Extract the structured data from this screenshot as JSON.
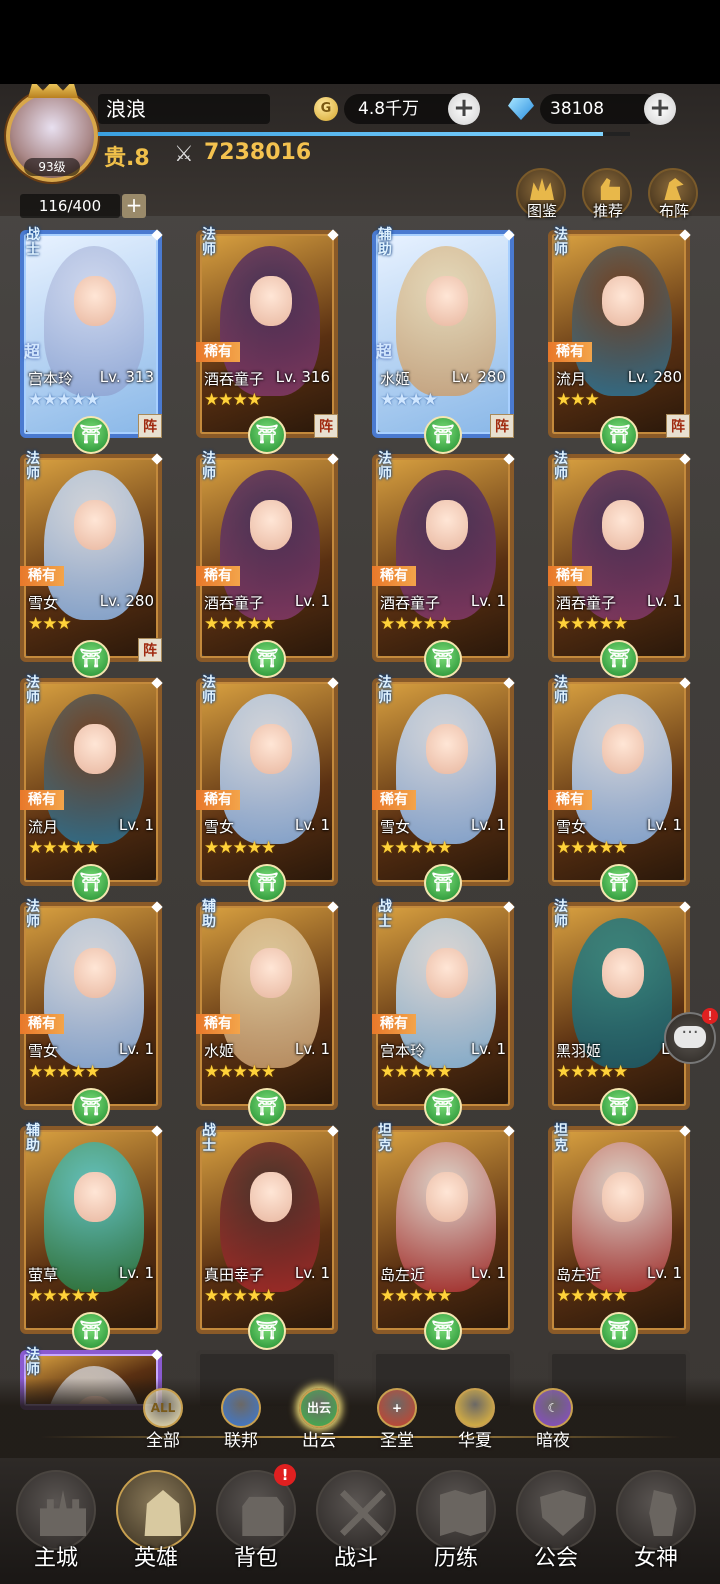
{
  "player": {
    "name": "浪浪",
    "level": "93级",
    "vip": "贵.8",
    "power": "7238016",
    "gold": "4.8千万",
    "gold_icon": "G",
    "diamonds": "38108",
    "hero_slots": "116/400",
    "exp_fraction": 0.95
  },
  "top_buttons": [
    {
      "icon": "crown-icon",
      "label": "图鉴"
    },
    {
      "icon": "thumbs-up-icon",
      "label": "推荐"
    },
    {
      "icon": "formation-icon",
      "label": "布阵"
    }
  ],
  "heroes": [
    {
      "name": "宫本玲",
      "level": "Lv. 313",
      "role": "战士",
      "rarity": "超",
      "stars": 5,
      "star_style": "blue",
      "frame": "blue",
      "faction": "出云",
      "in_formation": "阵"
    },
    {
      "name": "酒吞童子",
      "level": "Lv. 316",
      "role": "法师",
      "rarity": "稀有",
      "stars": 4,
      "star_style": "gold",
      "frame": "gold",
      "faction": "出云",
      "in_formation": "阵"
    },
    {
      "name": "水姬",
      "level": "Lv. 280",
      "role": "辅助",
      "rarity": "超",
      "stars": 4,
      "star_style": "blue",
      "frame": "blue",
      "faction": "出云",
      "in_formation": "阵"
    },
    {
      "name": "流月",
      "level": "Lv. 280",
      "role": "法师",
      "rarity": "稀有",
      "stars": 3,
      "star_style": "gold",
      "frame": "gold",
      "faction": "出云",
      "in_formation": "阵"
    },
    {
      "name": "雪女",
      "level": "Lv. 280",
      "role": "法师",
      "rarity": "稀有",
      "stars": 3,
      "star_style": "gold",
      "frame": "gold",
      "faction": "出云",
      "in_formation": "阵"
    },
    {
      "name": "酒吞童子",
      "level": "Lv. 1",
      "role": "法师",
      "rarity": "稀有",
      "stars": 5,
      "star_style": "gold",
      "frame": "gold",
      "faction": "出云",
      "in_formation": ""
    },
    {
      "name": "酒吞童子",
      "level": "Lv. 1",
      "role": "法师",
      "rarity": "稀有",
      "stars": 5,
      "star_style": "gold",
      "frame": "gold",
      "faction": "出云",
      "in_formation": ""
    },
    {
      "name": "酒吞童子",
      "level": "Lv. 1",
      "role": "法师",
      "rarity": "稀有",
      "stars": 5,
      "star_style": "gold",
      "frame": "gold",
      "faction": "出云",
      "in_formation": ""
    },
    {
      "name": "流月",
      "level": "Lv. 1",
      "role": "法师",
      "rarity": "稀有",
      "stars": 5,
      "star_style": "gold",
      "frame": "gold",
      "faction": "出云",
      "in_formation": ""
    },
    {
      "name": "雪女",
      "level": "Lv. 1",
      "role": "法师",
      "rarity": "稀有",
      "stars": 5,
      "star_style": "gold",
      "frame": "gold",
      "faction": "出云",
      "in_formation": ""
    },
    {
      "name": "雪女",
      "level": "Lv. 1",
      "role": "法师",
      "rarity": "稀有",
      "stars": 5,
      "star_style": "gold",
      "frame": "gold",
      "faction": "出云",
      "in_formation": ""
    },
    {
      "name": "雪女",
      "level": "Lv. 1",
      "role": "法师",
      "rarity": "稀有",
      "stars": 5,
      "star_style": "gold",
      "frame": "gold",
      "faction": "出云",
      "in_formation": ""
    },
    {
      "name": "雪女",
      "level": "Lv. 1",
      "role": "法师",
      "rarity": "稀有",
      "stars": 5,
      "star_style": "gold",
      "frame": "gold",
      "faction": "出云",
      "in_formation": ""
    },
    {
      "name": "水姬",
      "level": "Lv. 1",
      "role": "辅助",
      "rarity": "稀有",
      "stars": 5,
      "star_style": "gold",
      "frame": "gold",
      "faction": "出云",
      "in_formation": ""
    },
    {
      "name": "宫本玲",
      "level": "Lv. 1",
      "role": "战士",
      "rarity": "稀有",
      "stars": 5,
      "star_style": "gold",
      "frame": "gold",
      "faction": "出云",
      "in_formation": ""
    },
    {
      "name": "黑羽姬",
      "level": "Lv.",
      "role": "法师",
      "rarity": "",
      "stars": 5,
      "star_style": "gold",
      "frame": "gold",
      "faction": "出云",
      "in_formation": ""
    },
    {
      "name": "萤草",
      "level": "Lv. 1",
      "role": "辅助",
      "rarity": "",
      "stars": 5,
      "star_style": "gold",
      "frame": "gold",
      "faction": "出云",
      "in_formation": ""
    },
    {
      "name": "真田幸子",
      "level": "Lv. 1",
      "role": "战士",
      "rarity": "",
      "stars": 5,
      "star_style": "gold",
      "frame": "gold",
      "faction": "出云",
      "in_formation": ""
    },
    {
      "name": "岛左近",
      "level": "Lv. 1",
      "role": "坦克",
      "rarity": "",
      "stars": 5,
      "star_style": "gold",
      "frame": "gold",
      "faction": "出云",
      "in_formation": ""
    },
    {
      "name": "岛左近",
      "level": "Lv. 1",
      "role": "坦克",
      "rarity": "",
      "stars": 5,
      "star_style": "gold",
      "frame": "gold",
      "faction": "出云",
      "in_formation": ""
    },
    {
      "name": "",
      "level": "",
      "role": "法师",
      "rarity": "",
      "stars": 0,
      "star_style": "gold",
      "frame": "purple",
      "faction": "",
      "in_formation": ""
    },
    {
      "name": "",
      "level": "",
      "role": "",
      "rarity": "",
      "stars": 0,
      "star_style": "gold",
      "frame": "empty",
      "faction": "",
      "in_formation": ""
    },
    {
      "name": "",
      "level": "",
      "role": "",
      "rarity": "",
      "stars": 0,
      "star_style": "gold",
      "frame": "empty",
      "faction": "",
      "in_formation": ""
    },
    {
      "name": "",
      "level": "",
      "role": "",
      "rarity": "",
      "stars": 0,
      "star_style": "gold",
      "frame": "empty",
      "faction": "",
      "in_formation": ""
    }
  ],
  "faction_tabs": [
    {
      "label": "全部",
      "icon_text": "ALL",
      "color": "#f2e6b8",
      "icon": "all-icon"
    },
    {
      "label": "联邦",
      "icon_text": "",
      "color": "#3a7ad8",
      "icon": "gear-icon"
    },
    {
      "label": "出云",
      "icon_text": "出云",
      "color": "#3cb84a",
      "icon": "torii-icon",
      "active": true
    },
    {
      "label": "圣堂",
      "icon_text": "+",
      "color": "#d0402a",
      "icon": "cross-icon"
    },
    {
      "label": "华夏",
      "icon_text": "",
      "color": "#f0c03a",
      "icon": "sun-icon"
    },
    {
      "label": "暗夜",
      "icon_text": "☾",
      "color": "#8a4ad0",
      "icon": "moon-icon"
    }
  ],
  "chat": {
    "badge": "!",
    "dots": "···"
  },
  "nav": [
    {
      "label": "主城",
      "icon": "castle-icon"
    },
    {
      "label": "英雄",
      "icon": "hero-icon",
      "active": true
    },
    {
      "label": "背包",
      "icon": "backpack-icon",
      "alert": "!"
    },
    {
      "label": "战斗",
      "icon": "crossed-swords-icon"
    },
    {
      "label": "历练",
      "icon": "map-icon"
    },
    {
      "label": "公会",
      "icon": "guild-shield-icon"
    },
    {
      "label": "女神",
      "icon": "goddess-icon"
    }
  ]
}
